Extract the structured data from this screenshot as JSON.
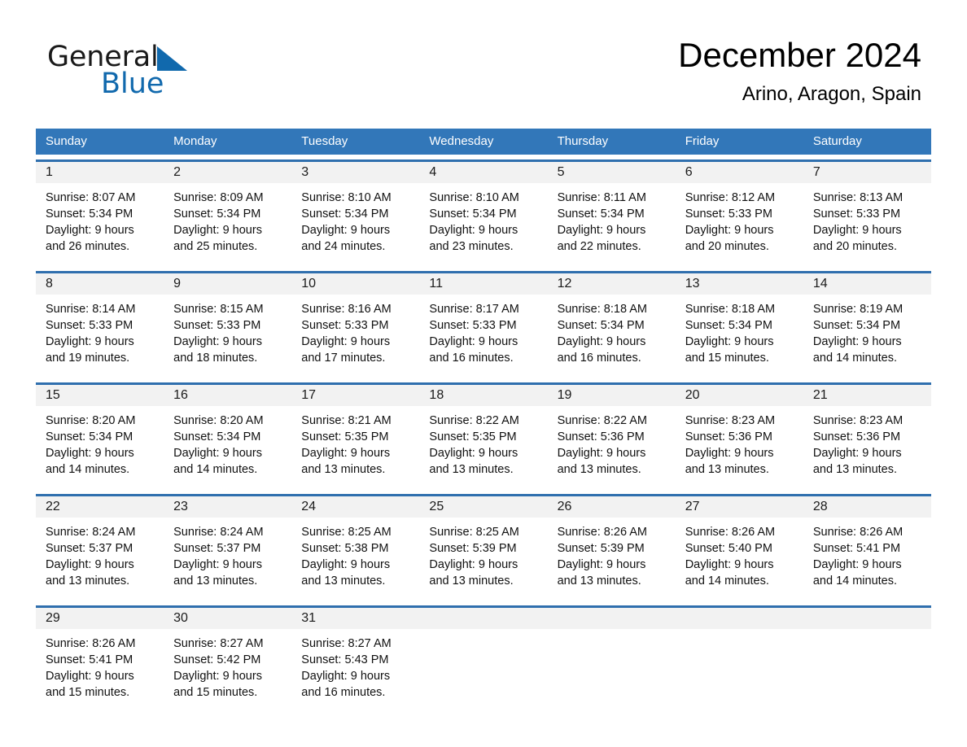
{
  "brand": {
    "name_part1": "General",
    "name_part2": "Blue",
    "accent_color": "#1169ad",
    "triangle_icon": "triangle-icon"
  },
  "header": {
    "title": "December 2024",
    "location": "Arino, Aragon, Spain"
  },
  "calendar": {
    "header_bg": "#3277b9",
    "header_text_color": "#ffffff",
    "day_band_bg": "#f2f2f2",
    "weekdays": [
      "Sunday",
      "Monday",
      "Tuesday",
      "Wednesday",
      "Thursday",
      "Friday",
      "Saturday"
    ],
    "weeks": [
      [
        {
          "day": "1",
          "sunrise": "Sunrise: 8:07 AM",
          "sunset": "Sunset: 5:34 PM",
          "daylight1": "Daylight: 9 hours",
          "daylight2": "and 26 minutes."
        },
        {
          "day": "2",
          "sunrise": "Sunrise: 8:09 AM",
          "sunset": "Sunset: 5:34 PM",
          "daylight1": "Daylight: 9 hours",
          "daylight2": "and 25 minutes."
        },
        {
          "day": "3",
          "sunrise": "Sunrise: 8:10 AM",
          "sunset": "Sunset: 5:34 PM",
          "daylight1": "Daylight: 9 hours",
          "daylight2": "and 24 minutes."
        },
        {
          "day": "4",
          "sunrise": "Sunrise: 8:10 AM",
          "sunset": "Sunset: 5:34 PM",
          "daylight1": "Daylight: 9 hours",
          "daylight2": "and 23 minutes."
        },
        {
          "day": "5",
          "sunrise": "Sunrise: 8:11 AM",
          "sunset": "Sunset: 5:34 PM",
          "daylight1": "Daylight: 9 hours",
          "daylight2": "and 22 minutes."
        },
        {
          "day": "6",
          "sunrise": "Sunrise: 8:12 AM",
          "sunset": "Sunset: 5:33 PM",
          "daylight1": "Daylight: 9 hours",
          "daylight2": "and 20 minutes."
        },
        {
          "day": "7",
          "sunrise": "Sunrise: 8:13 AM",
          "sunset": "Sunset: 5:33 PM",
          "daylight1": "Daylight: 9 hours",
          "daylight2": "and 20 minutes."
        }
      ],
      [
        {
          "day": "8",
          "sunrise": "Sunrise: 8:14 AM",
          "sunset": "Sunset: 5:33 PM",
          "daylight1": "Daylight: 9 hours",
          "daylight2": "and 19 minutes."
        },
        {
          "day": "9",
          "sunrise": "Sunrise: 8:15 AM",
          "sunset": "Sunset: 5:33 PM",
          "daylight1": "Daylight: 9 hours",
          "daylight2": "and 18 minutes."
        },
        {
          "day": "10",
          "sunrise": "Sunrise: 8:16 AM",
          "sunset": "Sunset: 5:33 PM",
          "daylight1": "Daylight: 9 hours",
          "daylight2": "and 17 minutes."
        },
        {
          "day": "11",
          "sunrise": "Sunrise: 8:17 AM",
          "sunset": "Sunset: 5:33 PM",
          "daylight1": "Daylight: 9 hours",
          "daylight2": "and 16 minutes."
        },
        {
          "day": "12",
          "sunrise": "Sunrise: 8:18 AM",
          "sunset": "Sunset: 5:34 PM",
          "daylight1": "Daylight: 9 hours",
          "daylight2": "and 16 minutes."
        },
        {
          "day": "13",
          "sunrise": "Sunrise: 8:18 AM",
          "sunset": "Sunset: 5:34 PM",
          "daylight1": "Daylight: 9 hours",
          "daylight2": "and 15 minutes."
        },
        {
          "day": "14",
          "sunrise": "Sunrise: 8:19 AM",
          "sunset": "Sunset: 5:34 PM",
          "daylight1": "Daylight: 9 hours",
          "daylight2": "and 14 minutes."
        }
      ],
      [
        {
          "day": "15",
          "sunrise": "Sunrise: 8:20 AM",
          "sunset": "Sunset: 5:34 PM",
          "daylight1": "Daylight: 9 hours",
          "daylight2": "and 14 minutes."
        },
        {
          "day": "16",
          "sunrise": "Sunrise: 8:20 AM",
          "sunset": "Sunset: 5:34 PM",
          "daylight1": "Daylight: 9 hours",
          "daylight2": "and 14 minutes."
        },
        {
          "day": "17",
          "sunrise": "Sunrise: 8:21 AM",
          "sunset": "Sunset: 5:35 PM",
          "daylight1": "Daylight: 9 hours",
          "daylight2": "and 13 minutes."
        },
        {
          "day": "18",
          "sunrise": "Sunrise: 8:22 AM",
          "sunset": "Sunset: 5:35 PM",
          "daylight1": "Daylight: 9 hours",
          "daylight2": "and 13 minutes."
        },
        {
          "day": "19",
          "sunrise": "Sunrise: 8:22 AM",
          "sunset": "Sunset: 5:36 PM",
          "daylight1": "Daylight: 9 hours",
          "daylight2": "and 13 minutes."
        },
        {
          "day": "20",
          "sunrise": "Sunrise: 8:23 AM",
          "sunset": "Sunset: 5:36 PM",
          "daylight1": "Daylight: 9 hours",
          "daylight2": "and 13 minutes."
        },
        {
          "day": "21",
          "sunrise": "Sunrise: 8:23 AM",
          "sunset": "Sunset: 5:36 PM",
          "daylight1": "Daylight: 9 hours",
          "daylight2": "and 13 minutes."
        }
      ],
      [
        {
          "day": "22",
          "sunrise": "Sunrise: 8:24 AM",
          "sunset": "Sunset: 5:37 PM",
          "daylight1": "Daylight: 9 hours",
          "daylight2": "and 13 minutes."
        },
        {
          "day": "23",
          "sunrise": "Sunrise: 8:24 AM",
          "sunset": "Sunset: 5:37 PM",
          "daylight1": "Daylight: 9 hours",
          "daylight2": "and 13 minutes."
        },
        {
          "day": "24",
          "sunrise": "Sunrise: 8:25 AM",
          "sunset": "Sunset: 5:38 PM",
          "daylight1": "Daylight: 9 hours",
          "daylight2": "and 13 minutes."
        },
        {
          "day": "25",
          "sunrise": "Sunrise: 8:25 AM",
          "sunset": "Sunset: 5:39 PM",
          "daylight1": "Daylight: 9 hours",
          "daylight2": "and 13 minutes."
        },
        {
          "day": "26",
          "sunrise": "Sunrise: 8:26 AM",
          "sunset": "Sunset: 5:39 PM",
          "daylight1": "Daylight: 9 hours",
          "daylight2": "and 13 minutes."
        },
        {
          "day": "27",
          "sunrise": "Sunrise: 8:26 AM",
          "sunset": "Sunset: 5:40 PM",
          "daylight1": "Daylight: 9 hours",
          "daylight2": "and 14 minutes."
        },
        {
          "day": "28",
          "sunrise": "Sunrise: 8:26 AM",
          "sunset": "Sunset: 5:41 PM",
          "daylight1": "Daylight: 9 hours",
          "daylight2": "and 14 minutes."
        }
      ],
      [
        {
          "day": "29",
          "sunrise": "Sunrise: 8:26 AM",
          "sunset": "Sunset: 5:41 PM",
          "daylight1": "Daylight: 9 hours",
          "daylight2": "and 15 minutes."
        },
        {
          "day": "30",
          "sunrise": "Sunrise: 8:27 AM",
          "sunset": "Sunset: 5:42 PM",
          "daylight1": "Daylight: 9 hours",
          "daylight2": "and 15 minutes."
        },
        {
          "day": "31",
          "sunrise": "Sunrise: 8:27 AM",
          "sunset": "Sunset: 5:43 PM",
          "daylight1": "Daylight: 9 hours",
          "daylight2": "and 16 minutes."
        },
        {
          "day": "",
          "sunrise": "",
          "sunset": "",
          "daylight1": "",
          "daylight2": ""
        },
        {
          "day": "",
          "sunrise": "",
          "sunset": "",
          "daylight1": "",
          "daylight2": ""
        },
        {
          "day": "",
          "sunrise": "",
          "sunset": "",
          "daylight1": "",
          "daylight2": ""
        },
        {
          "day": "",
          "sunrise": "",
          "sunset": "",
          "daylight1": "",
          "daylight2": ""
        }
      ]
    ]
  }
}
